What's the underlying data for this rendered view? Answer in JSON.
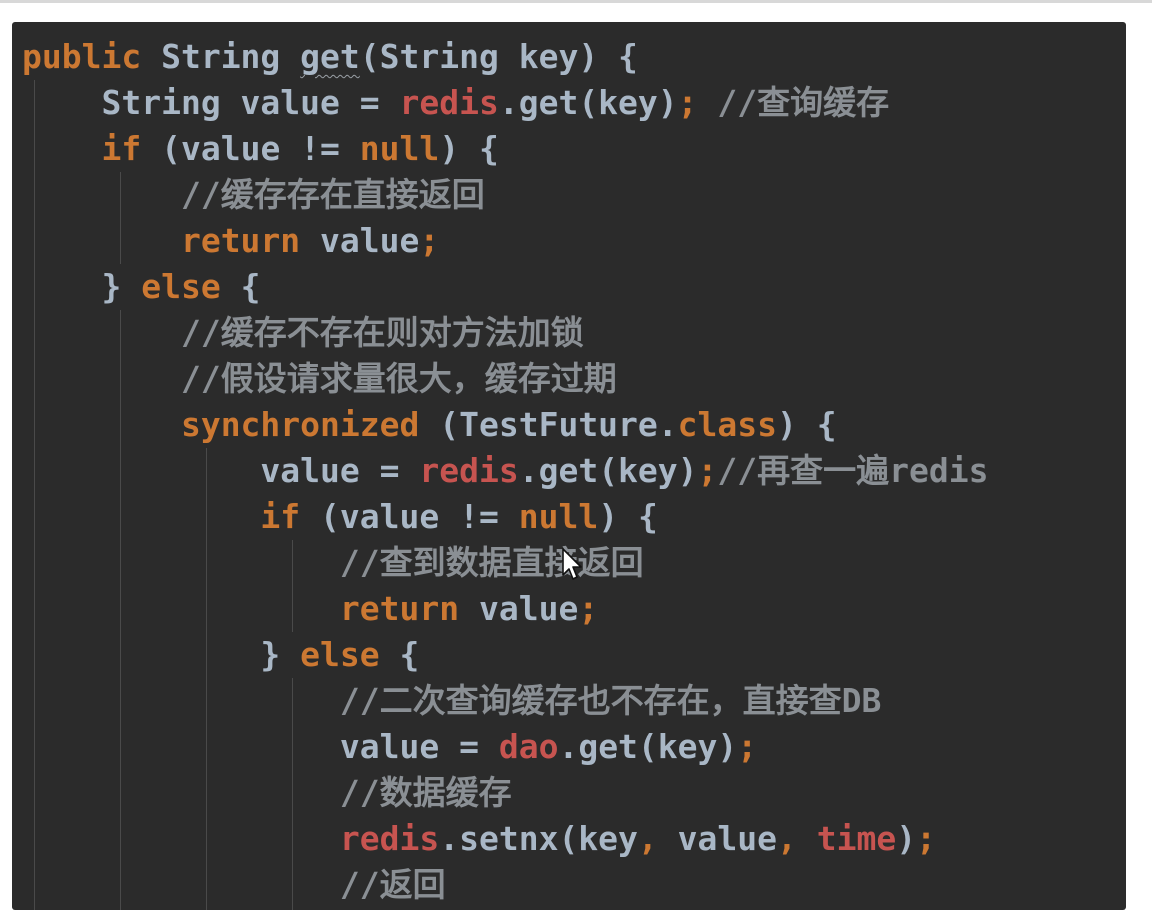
{
  "code": {
    "lines": [
      {
        "indent": "",
        "parts": [
          {
            "t": "public",
            "c": "kw"
          },
          {
            "t": " String ",
            "c": "pl"
          },
          {
            "t": "get",
            "c": "pl",
            "sq": true
          },
          {
            "t": "(String key) {",
            "c": "pl"
          }
        ]
      },
      {
        "indent": "    ",
        "parts": [
          {
            "t": "String value = ",
            "c": "pl"
          },
          {
            "t": "redis",
            "c": "fld"
          },
          {
            "t": ".get(key)",
            "c": "pl"
          },
          {
            "t": ";",
            "c": "kw"
          },
          {
            "t": " //查询缓存",
            "c": "cm"
          }
        ]
      },
      {
        "indent": "    ",
        "parts": [
          {
            "t": "if",
            "c": "kw"
          },
          {
            "t": " (value != ",
            "c": "pl"
          },
          {
            "t": "null",
            "c": "kw"
          },
          {
            "t": ") {",
            "c": "pl"
          }
        ]
      },
      {
        "indent": "        ",
        "parts": [
          {
            "t": "//缓存存在直接返回",
            "c": "cm"
          }
        ]
      },
      {
        "indent": "        ",
        "parts": [
          {
            "t": "return",
            "c": "kw"
          },
          {
            "t": " value",
            "c": "pl"
          },
          {
            "t": ";",
            "c": "kw"
          }
        ]
      },
      {
        "indent": "    ",
        "parts": [
          {
            "t": "} ",
            "c": "pl"
          },
          {
            "t": "else",
            "c": "kw"
          },
          {
            "t": " {",
            "c": "pl"
          }
        ]
      },
      {
        "indent": "        ",
        "parts": [
          {
            "t": "//缓存不存在则对方法加锁",
            "c": "cm"
          }
        ]
      },
      {
        "indent": "        ",
        "parts": [
          {
            "t": "//假设请求量很大，缓存过期",
            "c": "cm"
          }
        ]
      },
      {
        "indent": "        ",
        "parts": [
          {
            "t": "synchronized",
            "c": "kw"
          },
          {
            "t": " (TestFuture.",
            "c": "pl"
          },
          {
            "t": "class",
            "c": "kw"
          },
          {
            "t": ") {",
            "c": "pl"
          }
        ]
      },
      {
        "indent": "            ",
        "parts": [
          {
            "t": "value = ",
            "c": "pl"
          },
          {
            "t": "redis",
            "c": "fld"
          },
          {
            "t": ".get(key)",
            "c": "pl"
          },
          {
            "t": ";",
            "c": "kw"
          },
          {
            "t": "//再查一遍redis",
            "c": "cm"
          }
        ]
      },
      {
        "indent": "            ",
        "parts": [
          {
            "t": "if",
            "c": "kw"
          },
          {
            "t": " (value != ",
            "c": "pl"
          },
          {
            "t": "null",
            "c": "kw"
          },
          {
            "t": ") {",
            "c": "pl"
          }
        ]
      },
      {
        "indent": "                ",
        "parts": [
          {
            "t": "//查到数据直接返回",
            "c": "cm"
          }
        ]
      },
      {
        "indent": "                ",
        "parts": [
          {
            "t": "return",
            "c": "kw"
          },
          {
            "t": " value",
            "c": "pl"
          },
          {
            "t": ";",
            "c": "kw"
          }
        ]
      },
      {
        "indent": "            ",
        "parts": [
          {
            "t": "} ",
            "c": "pl"
          },
          {
            "t": "else",
            "c": "kw"
          },
          {
            "t": " {",
            "c": "pl"
          }
        ]
      },
      {
        "indent": "                ",
        "parts": [
          {
            "t": "//二次查询缓存也不存在，直接查DB",
            "c": "cm"
          }
        ]
      },
      {
        "indent": "                ",
        "parts": [
          {
            "t": "value = ",
            "c": "pl"
          },
          {
            "t": "dao",
            "c": "fld"
          },
          {
            "t": ".get(key)",
            "c": "pl"
          },
          {
            "t": ";",
            "c": "kw"
          }
        ]
      },
      {
        "indent": "                ",
        "parts": [
          {
            "t": "//数据缓存",
            "c": "cm"
          }
        ]
      },
      {
        "indent": "                ",
        "parts": [
          {
            "t": "redis",
            "c": "fld"
          },
          {
            "t": ".setnx(key",
            "c": "pl"
          },
          {
            "t": ",",
            "c": "kw"
          },
          {
            "t": " value",
            "c": "pl"
          },
          {
            "t": ",",
            "c": "kw"
          },
          {
            "t": " ",
            "c": "pl"
          },
          {
            "t": "time",
            "c": "fld"
          },
          {
            "t": ")",
            "c": "pl"
          },
          {
            "t": ";",
            "c": "kw"
          }
        ]
      },
      {
        "indent": "                ",
        "parts": [
          {
            "t": "//返回",
            "c": "cm"
          }
        ]
      }
    ]
  },
  "colors": {
    "background": "#2b2b2b",
    "keyword": "#cc7832",
    "field": "#c75450",
    "comment": "#8a8f94",
    "plain": "#a9b7c6"
  },
  "cursor": {
    "icon": "mouse-pointer-icon"
  }
}
